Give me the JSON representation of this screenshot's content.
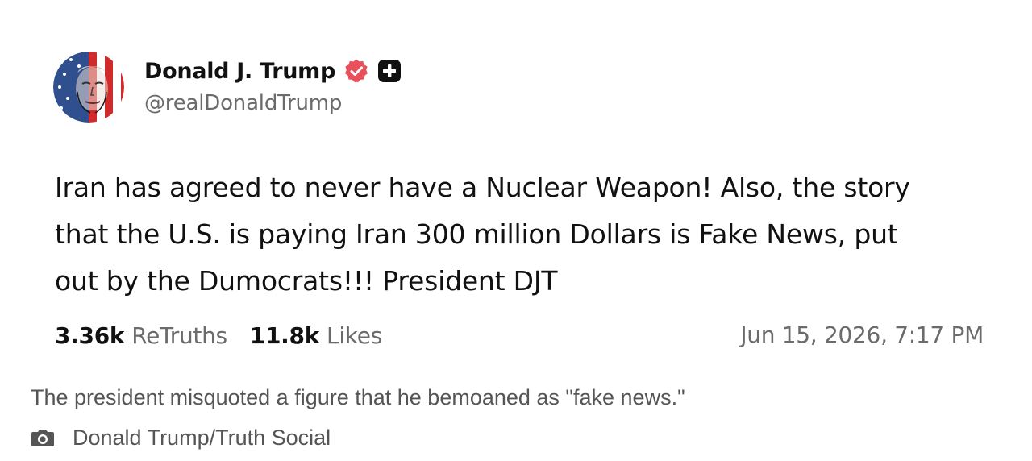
{
  "post": {
    "author": {
      "display_name": "Donald J. Trump",
      "handle": "@realDonaldTrump",
      "avatar_icon": "flag-portrait-avatar",
      "badges": [
        "verified-badge-icon",
        "plus-badge-icon"
      ]
    },
    "body_lines": [
      "Iran has agreed to never have a Nuclear Weapon! Also, the story",
      "that the U.S. is paying Iran 300 million Dollars is Fake News, put",
      "out by the Dumocrats!!! President DJT"
    ],
    "stats": {
      "retruths_count": "3.36k",
      "retruths_label": "ReTruths",
      "likes_count": "11.8k",
      "likes_label": "Likes"
    },
    "timestamp": "Jun 15, 2026, 7:17 PM"
  },
  "caption": {
    "text": "The president misquoted a figure that he bemoaned as \"fake news.\"",
    "credit": "Donald Trump/Truth Social",
    "credit_icon": "camera-icon"
  },
  "colors": {
    "verified_badge": "#e8505b",
    "text_primary": "#111111",
    "text_secondary": "#6b6b6b",
    "caption_text": "#555555"
  }
}
